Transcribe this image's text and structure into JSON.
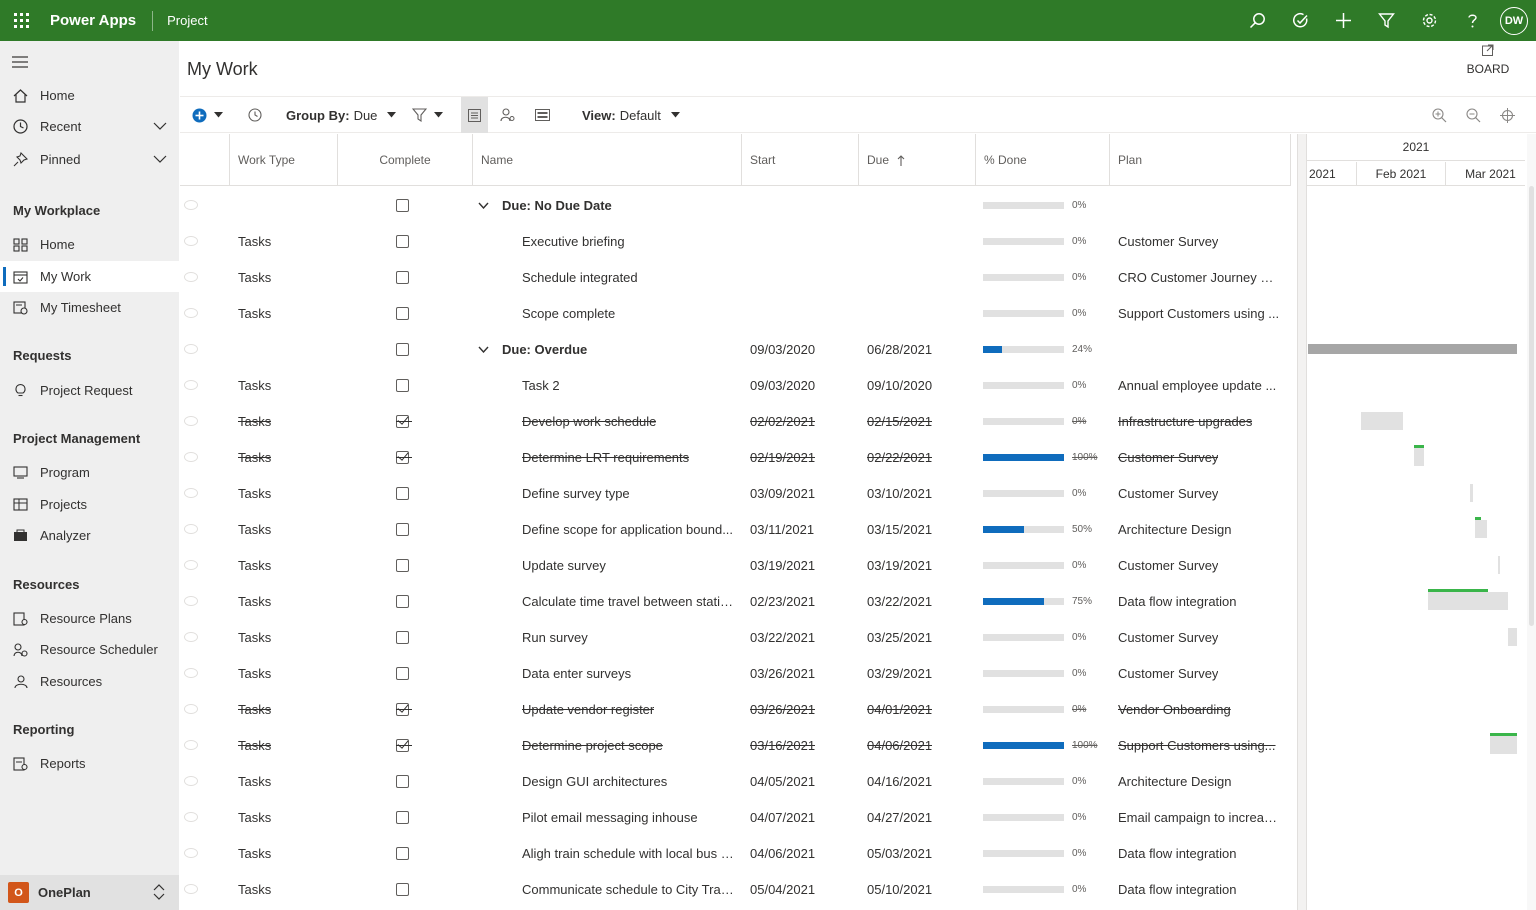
{
  "topbar": {
    "app_name": "Power Apps",
    "environment": "Project",
    "avatar_initials": "DW",
    "icons": [
      "search-icon",
      "check-circle-icon",
      "add-icon",
      "filter-icon",
      "gear-icon",
      "help-icon"
    ],
    "background_color": "#2f7a28"
  },
  "sidebar": {
    "top_items": [
      {
        "label": "Home",
        "icon": "home-icon"
      },
      {
        "label": "Recent",
        "icon": "clock-icon"
      },
      {
        "label": "Pinned",
        "icon": "pin-icon"
      }
    ],
    "sections": [
      {
        "title": "My Workplace",
        "items": [
          {
            "label": "Home",
            "icon": "dashboard-icon"
          },
          {
            "label": "My Work",
            "icon": "calendar-icon",
            "active": true
          },
          {
            "label": "My Timesheet",
            "icon": "timesheet-icon"
          }
        ]
      },
      {
        "title": "Requests",
        "items": [
          {
            "label": "Project Request",
            "icon": "lightbulb-icon"
          }
        ]
      },
      {
        "title": "Project Management",
        "items": [
          {
            "label": "Program",
            "icon": "program-icon"
          },
          {
            "label": "Projects",
            "icon": "projects-icon"
          },
          {
            "label": "Analyzer",
            "icon": "analyzer-icon"
          }
        ]
      },
      {
        "title": "Resources",
        "items": [
          {
            "label": "Resource Plans",
            "icon": "resource-plans-icon"
          },
          {
            "label": "Resource Scheduler",
            "icon": "resource-scheduler-icon"
          },
          {
            "label": "Resources",
            "icon": "people-icon"
          }
        ]
      },
      {
        "title": "Reporting",
        "items": [
          {
            "label": "Reports",
            "icon": "reports-icon"
          }
        ]
      }
    ],
    "environment": {
      "badge": "O",
      "name": "OnePlan",
      "badge_color": "#d2561a"
    }
  },
  "page": {
    "title": "My Work",
    "board_label": "BOARD"
  },
  "toolbar": {
    "group_by_label": "Group By:",
    "group_by_value": "Due",
    "view_label": "View:",
    "view_value": "Default"
  },
  "grid": {
    "columns": [
      "Work Type",
      "Complete",
      "Name",
      "Start",
      "Due",
      "% Done",
      "Plan"
    ],
    "rows": [
      {
        "group": true,
        "name": "Due: No Due Date",
        "type": "",
        "done": false,
        "start": "",
        "due": "",
        "pct": 0,
        "pct_label": "0%",
        "plan": ""
      },
      {
        "type": "Tasks",
        "done": false,
        "name": "Executive briefing",
        "start": "",
        "due": "",
        "pct": 0,
        "pct_label": "0%",
        "plan": "Customer Survey"
      },
      {
        "type": "Tasks",
        "done": false,
        "name": "Schedule integrated",
        "start": "",
        "due": "",
        "pct": 0,
        "pct_label": "0%",
        "plan": "CRO Customer Journey Mo..."
      },
      {
        "type": "Tasks",
        "done": false,
        "name": "Scope complete",
        "start": "",
        "due": "",
        "pct": 0,
        "pct_label": "0%",
        "plan": "Support Customers using ..."
      },
      {
        "group": true,
        "name": "Due: Overdue",
        "type": "",
        "done": false,
        "start": "09/03/2020",
        "due": "06/28/2021",
        "pct": 24,
        "pct_label": "24%",
        "plan": ""
      },
      {
        "type": "Tasks",
        "done": false,
        "name": "Task 2",
        "start": "09/03/2020",
        "due": "09/10/2020",
        "pct": 0,
        "pct_label": "0%",
        "plan": "Annual employee update ..."
      },
      {
        "type": "Tasks",
        "done": true,
        "name": "Develop work schedule",
        "start": "02/02/2021",
        "due": "02/15/2021",
        "pct": 0,
        "pct_label": "0%",
        "plan": "Infrastructure upgrades"
      },
      {
        "type": "Tasks",
        "done": true,
        "name": "Determine LRT requirements",
        "start": "02/19/2021",
        "due": "02/22/2021",
        "pct": 100,
        "pct_label": "100%",
        "plan": "Customer Survey"
      },
      {
        "type": "Tasks",
        "done": false,
        "name": "Define survey type",
        "start": "03/09/2021",
        "due": "03/10/2021",
        "pct": 0,
        "pct_label": "0%",
        "plan": "Customer Survey"
      },
      {
        "type": "Tasks",
        "done": false,
        "name": "Define scope for application bound...",
        "start": "03/11/2021",
        "due": "03/15/2021",
        "pct": 50,
        "pct_label": "50%",
        "plan": "Architecture Design"
      },
      {
        "type": "Tasks",
        "done": false,
        "name": "Update survey",
        "start": "03/19/2021",
        "due": "03/19/2021",
        "pct": 0,
        "pct_label": "0%",
        "plan": "Customer Survey"
      },
      {
        "type": "Tasks",
        "done": false,
        "name": "Calculate time travel between stations",
        "start": "02/23/2021",
        "due": "03/22/2021",
        "pct": 75,
        "pct_label": "75%",
        "plan": "Data flow integration"
      },
      {
        "type": "Tasks",
        "done": false,
        "name": "Run survey",
        "start": "03/22/2021",
        "due": "03/25/2021",
        "pct": 0,
        "pct_label": "0%",
        "plan": "Customer Survey"
      },
      {
        "type": "Tasks",
        "done": false,
        "name": "Data enter surveys",
        "start": "03/26/2021",
        "due": "03/29/2021",
        "pct": 0,
        "pct_label": "0%",
        "plan": "Customer Survey"
      },
      {
        "type": "Tasks",
        "done": true,
        "name": "Update vendor register",
        "start": "03/26/2021",
        "due": "04/01/2021",
        "pct": 0,
        "pct_label": "0%",
        "plan": "Vendor Onboarding"
      },
      {
        "type": "Tasks",
        "done": true,
        "name": "Determine project scope",
        "start": "03/16/2021",
        "due": "04/06/2021",
        "pct": 100,
        "pct_label": "100%",
        "plan": "Support Customers using..."
      },
      {
        "type": "Tasks",
        "done": false,
        "name": "Design GUI architectures",
        "start": "04/05/2021",
        "due": "04/16/2021",
        "pct": 0,
        "pct_label": "0%",
        "plan": "Architecture Design"
      },
      {
        "type": "Tasks",
        "done": false,
        "name": "Pilot email messaging inhouse",
        "start": "04/07/2021",
        "due": "04/27/2021",
        "pct": 0,
        "pct_label": "0%",
        "plan": "Email campaign to increase..."
      },
      {
        "type": "Tasks",
        "done": false,
        "name": "Aligh train schedule with local bus s...",
        "start": "04/06/2021",
        "due": "05/03/2021",
        "pct": 0,
        "pct_label": "0%",
        "plan": "Data flow integration"
      },
      {
        "type": "Tasks",
        "done": false,
        "name": "Communicate schedule to City Traffi...",
        "start": "05/04/2021",
        "due": "05/10/2021",
        "pct": 0,
        "pct_label": "0%",
        "plan": "Data flow integration"
      }
    ]
  },
  "gantt": {
    "year": "2021",
    "months": [
      "2021",
      "Feb 2021",
      "Mar 2021"
    ],
    "bar_color": "#e1e1e1",
    "progress_color": "#3ab54a"
  }
}
